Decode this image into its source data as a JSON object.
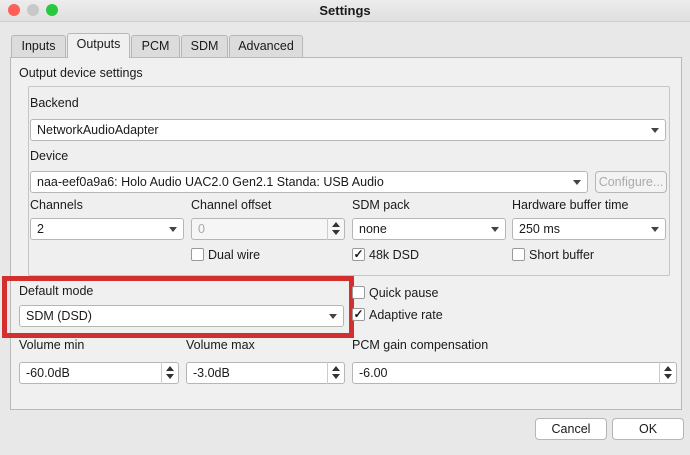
{
  "window": {
    "title": "Settings"
  },
  "tabs": [
    {
      "label": "Inputs"
    },
    {
      "label": "Outputs"
    },
    {
      "label": "PCM"
    },
    {
      "label": "SDM"
    },
    {
      "label": "Advanced"
    }
  ],
  "output": {
    "section_title": "Output device settings",
    "backend": {
      "label": "Backend",
      "value": "NetworkAudioAdapter"
    },
    "device": {
      "label": "Device",
      "value": "naa-eef0a9a6: Holo Audio UAC2.0 Gen2.1 Standa: USB Audio",
      "configure_label": "Configure..."
    },
    "channels": {
      "label": "Channels",
      "value": "2"
    },
    "channel_offset": {
      "label": "Channel offset",
      "value": "0"
    },
    "sdm_pack": {
      "label": "SDM pack",
      "value": "none"
    },
    "hw_buffer": {
      "label": "Hardware buffer time",
      "value": "250 ms"
    },
    "dual_wire": {
      "label": "Dual wire",
      "checked": false
    },
    "dsd48k": {
      "label": "48k DSD",
      "checked": true
    },
    "short_buffer": {
      "label": "Short buffer",
      "checked": false
    }
  },
  "default_mode": {
    "label": "Default mode",
    "value": "SDM (DSD)"
  },
  "quick_pause": {
    "label": "Quick pause",
    "checked": false
  },
  "adaptive_rate": {
    "label": "Adaptive rate",
    "checked": true
  },
  "volume_min": {
    "label": "Volume min",
    "value": "-60.0dB"
  },
  "volume_max": {
    "label": "Volume max",
    "value": "-3.0dB"
  },
  "pcm_gain": {
    "label": "PCM gain compensation",
    "value": "-6.00"
  },
  "buttons": {
    "cancel": "Cancel",
    "ok": "OK"
  },
  "checkmark": "✓",
  "colors": {
    "close": "#fe5f57",
    "minimize": "#c8c8c8",
    "maximize": "#28c840",
    "highlight": "#d32f2f"
  }
}
